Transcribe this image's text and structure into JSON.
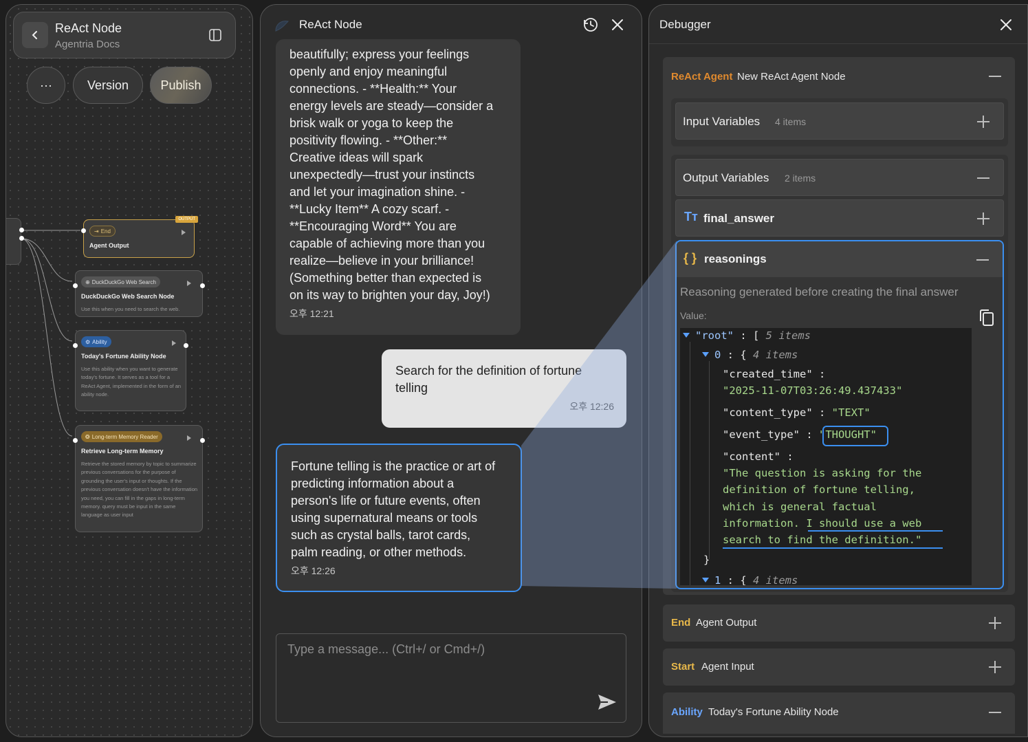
{
  "left": {
    "title": "ReAct Node",
    "subtitle": "Agentria Docs",
    "more_label": "···",
    "version_label": "Version",
    "publish_label": "Publish",
    "nodes": {
      "end": {
        "tag": "End",
        "badge": "OUTPUT",
        "title": "Agent Output"
      },
      "ddg": {
        "tag": "DuckDuckGo Web Search",
        "title": "DuckDuckGo Web Search Node",
        "desc": "Use this when you need to search the web."
      },
      "ability": {
        "tag": "Ability",
        "title": "Today's Fortune Ability Node",
        "desc": "Use this ability when you want to generate today's fortune. It serves as a tool for a ReAct Agent, implemented in the form of an ability node."
      },
      "memory": {
        "tag": "Long-term Memory Reader",
        "title": "Retrieve Long-term Memory",
        "desc": "Retrieve the stored memory by topic to summarize previous conversations for the purpose of grounding the user's input or thoughts. If the previous conversation doesn't have the information you need, you can fill in the gaps in long-term memory. query must be input in the same language as user input"
      }
    }
  },
  "chat": {
    "title": "ReAct Node",
    "messages": [
      {
        "role": "assistant",
        "lines": [
          "beautifully; express your feelings",
          "openly and enjoy meaningful",
          "connections. - **Health:** Your",
          "energy levels are steady—consider a",
          "brisk walk or yoga to keep the",
          "positivity flowing. - **Other:**",
          "Creative ideas will spark",
          "unexpectedly—trust your instincts",
          "and let your imagination shine. -",
          "**Lucky Item** A cozy scarf. -",
          "**Encouraging Word** You are",
          "capable of achieving more than you",
          "realize—believe in your brilliance!",
          "(Something better than expected is",
          "on its way to brighten your day, Joy!)"
        ],
        "time": "오후 12:21"
      },
      {
        "role": "user",
        "lines": [
          "Search for the definition of fortune",
          "telling"
        ],
        "time": "오후 12:26"
      },
      {
        "role": "assistant",
        "lines": [
          "Fortune telling is the practice or art of",
          "predicting information about a",
          "person's life or future events, often",
          "using supernatural means or tools",
          "such as crystal balls, tarot cards,",
          "palm reading, or other methods."
        ],
        "time": "오후 12:26"
      }
    ],
    "input_placeholder": "Type a message... (Ctrl+/ or Cmd+/)"
  },
  "debugger": {
    "title": "Debugger",
    "agent": {
      "type": "ReAct Agent",
      "name": "New ReAct Agent Node"
    },
    "input_vars": {
      "label": "Input Variables",
      "count": "4 items"
    },
    "output_vars": {
      "label": "Output Variables",
      "count": "2 items"
    },
    "final_answer": {
      "label": "final_answer"
    },
    "reasonings": {
      "label": "reasonings",
      "description": "Reasoning generated before creating the final answer",
      "value_label": "Value:",
      "json": {
        "root_key": "\"root\"",
        "root_count": "5 items",
        "item0_key": "0",
        "item0_count": "4 items",
        "created_time_key": "\"created_time\"",
        "created_time_val": "\"2025-11-07T03:26:49.437433\"",
        "content_type_key": "\"content_type\"",
        "content_type_val": "\"TEXT\"",
        "event_type_key": "\"event_type\"",
        "event_type_val": "\"THOUGHT\"",
        "content_key": "\"content\"",
        "content_lines": [
          "\"The question is asking for the",
          "definition of fortune telling,",
          "which is general factual",
          "information. I should use a web",
          "search to find the definition.\""
        ],
        "item1_key": "1",
        "item1_count": "4 items"
      }
    },
    "nodes": [
      {
        "type": "End",
        "name": "Agent Output"
      },
      {
        "type": "Start",
        "name": "Agent Input"
      },
      {
        "type": "Ability",
        "name": "Today's Fortune Ability Node"
      }
    ]
  },
  "colors": {
    "accent_blue": "#3b8ff0",
    "react_orange": "#e08a2e",
    "end_yellow": "#e8b84a",
    "ability_blue": "#6aa6ff"
  }
}
